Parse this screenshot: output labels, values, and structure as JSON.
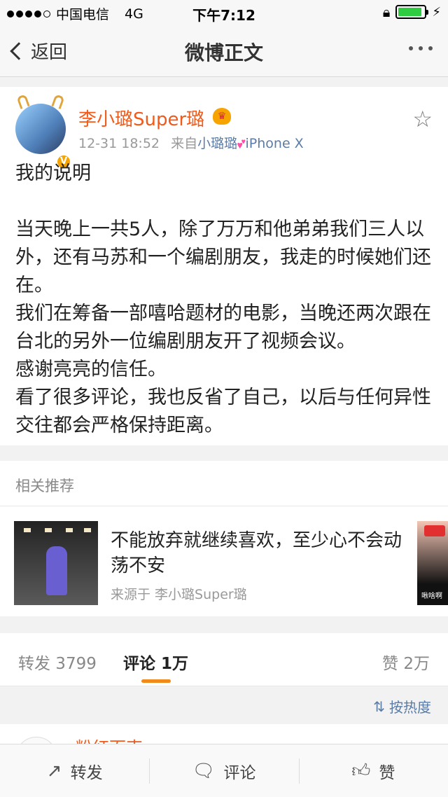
{
  "status_bar": {
    "carrier": "中国电信",
    "network": "4G",
    "time": "下午7:12",
    "battery_level_percent": 90
  },
  "nav": {
    "back_label": "返回",
    "title": "微博正文"
  },
  "post": {
    "username": "李小璐Super璐",
    "timestamp": "12-31 18:52",
    "source_prefix": "来自",
    "source_name": "小璐璐",
    "source_device": "iPhone X",
    "body": [
      "我的说明",
      "",
      "当天晚上一共5人，除了万万和他弟弟我们三人以外，还有马苏和一个编剧朋友，我走的时候她们还在。",
      "我们在筹备一部嘻哈题材的电影，当晚还两次跟在台北的另外一位编剧朋友开了视频会议。",
      "感谢亮亮的信任。",
      "看了很多评论，我也反省了自己，以后与任何异性交往都会严格保持距离。"
    ]
  },
  "related": {
    "title": "相关推荐",
    "item": {
      "text": "不能放弃就继续喜欢，至少心不会动荡不安",
      "source": "来源于 李小璐Super璐"
    },
    "side_caption": "啾啥啊"
  },
  "stats": {
    "repost_label": "转发 3799",
    "comment_label": "评论 1万",
    "like_label": "赞 2万"
  },
  "sort": {
    "label": "按热度"
  },
  "comment_preview": {
    "name": "粉红面束"
  },
  "toolbar": {
    "repost": "转发",
    "comment": "评论",
    "like": "赞"
  },
  "colors": {
    "username": "#f05a1a",
    "link": "#5b7ca6",
    "tab_underline": "#f08a1a"
  }
}
